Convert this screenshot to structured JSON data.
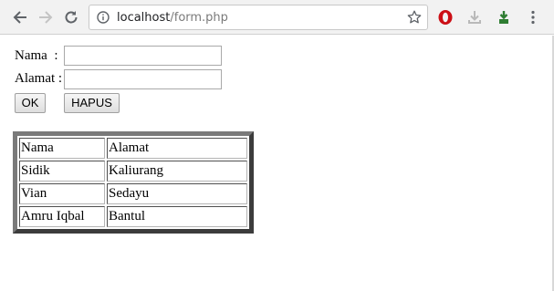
{
  "browser": {
    "url_host": "localhost",
    "url_path": "/form.php",
    "icons": {
      "back": "back-arrow-icon",
      "forward": "forward-arrow-icon",
      "reload": "reload-icon",
      "info": "info-icon",
      "bookmark": "star-icon",
      "opera": "opera-icon",
      "download": "download-icon",
      "extension": "extension-icon",
      "menu": "menu-icon"
    }
  },
  "form": {
    "nama_label": "Nama  :",
    "alamat_label": "Alamat :",
    "nama_value": "",
    "alamat_value": "",
    "ok_button": "OK",
    "hapus_button": "HAPUS"
  },
  "table": {
    "headers": [
      "Nama",
      "Alamat"
    ],
    "rows": [
      [
        "Sidik",
        "Kaliurang"
      ],
      [
        "Vian",
        "Sedayu"
      ],
      [
        "Amru Iqbal",
        "Bantul"
      ]
    ]
  },
  "colors": {
    "toolbar_bg": "#f2f2f2",
    "opera_red": "#cc0f16",
    "extension_green": "#2e7d32"
  }
}
